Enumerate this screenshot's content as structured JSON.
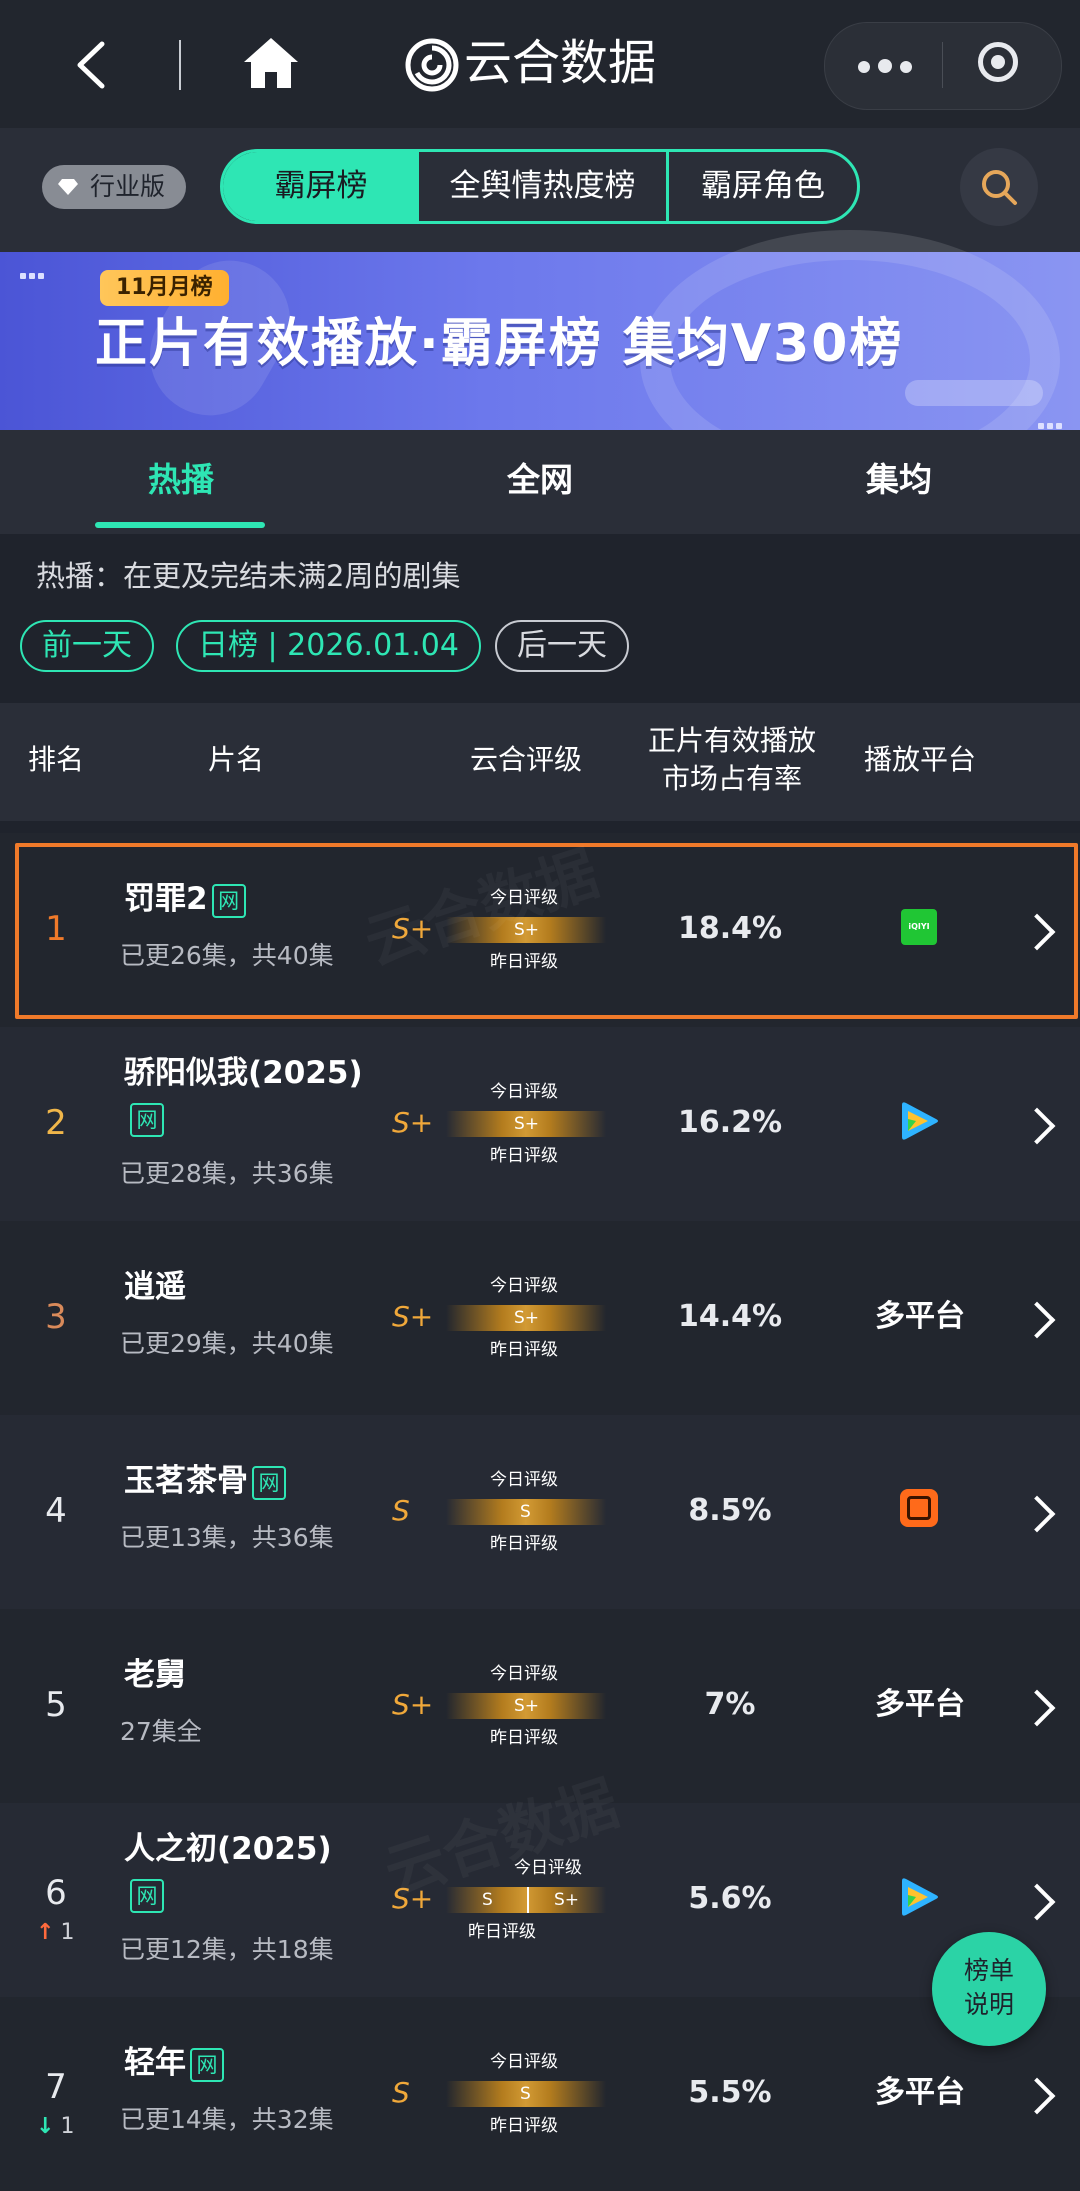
{
  "nav": {
    "title": "云合数据"
  },
  "filters": {
    "industry_label": "行业版",
    "segments": [
      "霸屏榜",
      "全舆情热度榜",
      "霸屏角色"
    ]
  },
  "banner": {
    "badge": "11月月榜",
    "title": "正片有效播放·霸屏榜 集均V30榜"
  },
  "tabs": [
    "热播",
    "全网",
    "集均"
  ],
  "description": "热播：在更及完结未满2周的剧集",
  "date_nav": {
    "prev": "前一天",
    "current": "日榜 | 2026.01.04",
    "next": "后一天"
  },
  "table": {
    "headers": {
      "rank": "排名",
      "name": "片名",
      "grade": "云合评级",
      "share_line1": "正片有效播放",
      "share_line2": "市场占有率",
      "platform": "播放平台"
    },
    "grade_today_label": "今日评级",
    "grade_yesterday_label": "昨日评级",
    "rows": [
      {
        "rank": "1",
        "name": "罚罪2",
        "net": "网",
        "eps": "已更26集，共40集",
        "grade": "S+",
        "today": "S+",
        "yesterday": "",
        "share": "18.4%",
        "platform": "iqiyi-icon",
        "platform_text": "iQIYI"
      },
      {
        "rank": "2",
        "name": "骄阳似我(2025)",
        "net": "网",
        "eps": "已更28集，共36集",
        "grade": "S+",
        "today": "S+",
        "yesterday": "",
        "share": "16.2%",
        "platform": "tencent-video-icon",
        "platform_text": ""
      },
      {
        "rank": "3",
        "name": "逍遥",
        "net": "",
        "eps": "已更29集，共40集",
        "grade": "S+",
        "today": "S+",
        "yesterday": "",
        "share": "14.4%",
        "platform": "",
        "platform_text": "多平台"
      },
      {
        "rank": "4",
        "name": "玉茗茶骨",
        "net": "网",
        "eps": "已更13集，共36集",
        "grade": "S",
        "today": "S",
        "yesterday": "",
        "share": "8.5%",
        "platform": "mango-tv-icon",
        "platform_text": ""
      },
      {
        "rank": "5",
        "name": "老舅",
        "net": "",
        "eps": "27集全",
        "grade": "S+",
        "today": "S+",
        "yesterday": "",
        "share": "7%",
        "platform": "",
        "platform_text": "多平台"
      },
      {
        "rank": "6",
        "name": "人之初(2025)",
        "net": "网",
        "eps": "已更12集，共18集",
        "grade": "S+",
        "today": "S+",
        "yesterday": "S",
        "share": "5.6%",
        "platform": "tencent-video-icon",
        "platform_text": "",
        "change_dir": "up",
        "change": "1"
      },
      {
        "rank": "7",
        "name": "轻年",
        "net": "网",
        "eps": "已更14集，共32集",
        "grade": "S",
        "today": "S",
        "yesterday": "",
        "share": "5.5%",
        "platform": "",
        "platform_text": "多平台",
        "change_dir": "down",
        "change": "1"
      }
    ]
  },
  "float_button": {
    "line1": "榜单",
    "line2": "说明"
  },
  "colors": {
    "accent": "#2ee6b4",
    "highlight_border": "#f07a2a",
    "grade": "#f0a83a",
    "rank_gold": "#f0b64a",
    "rank_bronze": "#d98a5a",
    "up": "#ff6a3d",
    "down": "#2ee6b4"
  }
}
